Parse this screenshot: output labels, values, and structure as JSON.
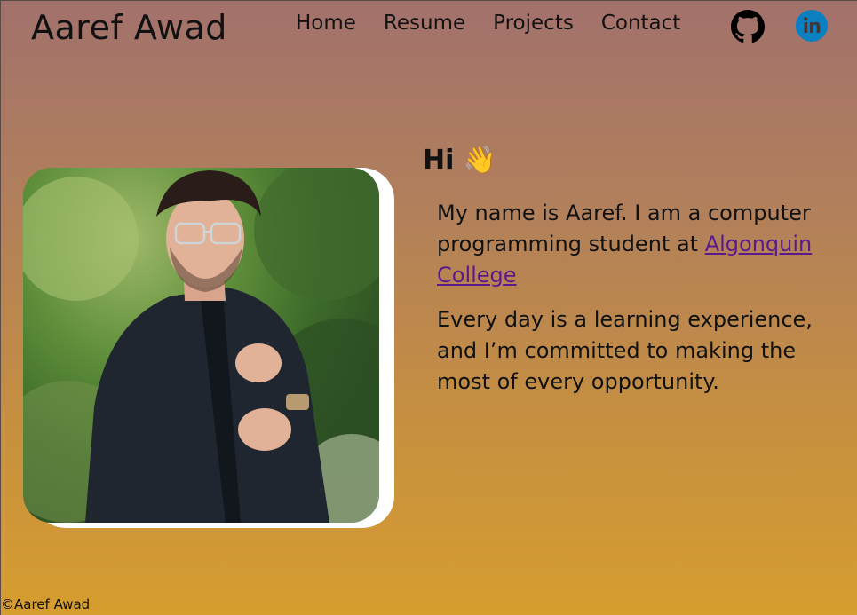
{
  "header": {
    "site_title": "Aaref Awad",
    "nav": [
      "Home",
      "Resume",
      "Projects",
      "Contact"
    ],
    "icons": [
      "github-icon",
      "linkedin-icon"
    ]
  },
  "intro": {
    "heading": "Hi 👋",
    "p1_text": "My name is Aaref. I am a computer programming student at ",
    "p1_link": "Algonquin College",
    "p2_text": "Every day is a learning experience, and I’m committed to making the most of every opportunity."
  },
  "footer": {
    "copyright": "©Aaref Awad"
  },
  "colors": {
    "bg_top": "#a2716c",
    "bg_bottom": "#d69d2f",
    "link": "#5b1a8c",
    "linkedin": "#0a7fc2"
  }
}
